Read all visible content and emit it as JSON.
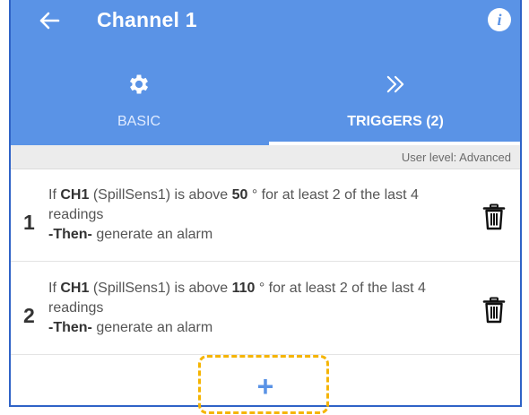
{
  "header": {
    "title": "Channel 1",
    "back_icon": "arrow-left-icon",
    "info_icon": "info-icon",
    "info_glyph": "i"
  },
  "tabs": [
    {
      "label": "BASIC",
      "icon": "gear-icon",
      "selected": false
    },
    {
      "label": "TRIGGERS (2)",
      "icon": "double-chevron-right-icon",
      "selected": true
    }
  ],
  "user_level": "User level: Advanced",
  "triggers": [
    {
      "number": "1",
      "if_label": "If",
      "channel": "CH1",
      "sensor": "(SpillSens1) is above",
      "threshold": "50",
      "condition_rest": "° for at least 2 of the last 4 readings",
      "then_label": "-Then-",
      "action": "generate an alarm",
      "delete_icon": "trash-icon"
    },
    {
      "number": "2",
      "if_label": "If",
      "channel": "CH1",
      "sensor": "(SpillSens1) is above",
      "threshold": "110",
      "condition_rest": "° for at least 2 of the last 4 readings",
      "then_label": "-Then-",
      "action": "generate an alarm",
      "delete_icon": "trash-icon"
    }
  ],
  "add_button": {
    "glyph": "+",
    "icon": "plus-icon"
  },
  "colors": {
    "app_bar": "#5a93e6",
    "highlight_border": "#f5b400",
    "frame_border": "#2f63c7"
  }
}
